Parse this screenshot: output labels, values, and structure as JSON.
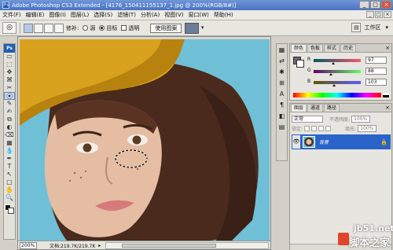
{
  "window": {
    "title": "Adobe Photoshop CS3 Extended - [4176_150411155137_1.jpg @ 200%(RGB/8#)]",
    "app_icon": "Ps",
    "minimize": "_",
    "maximize": "□",
    "close": "×"
  },
  "menubar": {
    "items": [
      "文件(F)",
      "编辑(E)",
      "图像(I)",
      "图层(L)",
      "选择(S)",
      "滤镜(T)",
      "分析(A)",
      "视图(V)",
      "窗口(W)",
      "帮助(H)"
    ],
    "doc_controls": [
      "_",
      "□",
      "×"
    ]
  },
  "options": {
    "repair_label": "修补:",
    "source_label": "源",
    "destination_label": "目标",
    "transparent_label": "透明",
    "use_pattern_label": "使用图案",
    "workspace_label": "工作区",
    "workspace_arrow": "▾"
  },
  "toolbox": {
    "logo": "Ps",
    "tools": [
      "▭",
      "⬚",
      "✥",
      "⌘",
      "✂",
      "⦿",
      "✎",
      "✍",
      "⧉",
      "◐",
      "⌫",
      "▦",
      "💧",
      "✒",
      "T",
      "↖",
      "▢",
      "✋",
      "🔍"
    ]
  },
  "document": {
    "zoom": "200%",
    "doc_info": "文档:219.7K/219.7K",
    "status_arrow": "▸"
  },
  "dock": {
    "icons": [
      "▦",
      "⇄",
      "✱",
      "⊞",
      "A",
      "¶",
      "◧",
      "▤"
    ]
  },
  "color_panel": {
    "tabs": [
      "颜色",
      "色板",
      "样式",
      "历史"
    ],
    "close": "×",
    "channels": [
      {
        "name": "R",
        "value": "97",
        "color": "#c0392b"
      },
      {
        "name": "G",
        "value": "88",
        "color": "#27ae60"
      },
      {
        "name": "B",
        "value": "103",
        "color": "#2c3e9e"
      }
    ]
  },
  "layers_panel": {
    "tabs": [
      "图层",
      "通道",
      "路径"
    ],
    "close": "×",
    "blend_mode": "正常",
    "opacity_label": "不透明度:",
    "opacity_value": "100%",
    "lock_label": "锁定:",
    "fill_label": "填充:",
    "fill_value": "100%",
    "layer_name": "背景",
    "layer_visible": "👁",
    "layer_lock": "🔒"
  },
  "watermark": {
    "url": "jb51.net",
    "title": "脚本之家"
  }
}
